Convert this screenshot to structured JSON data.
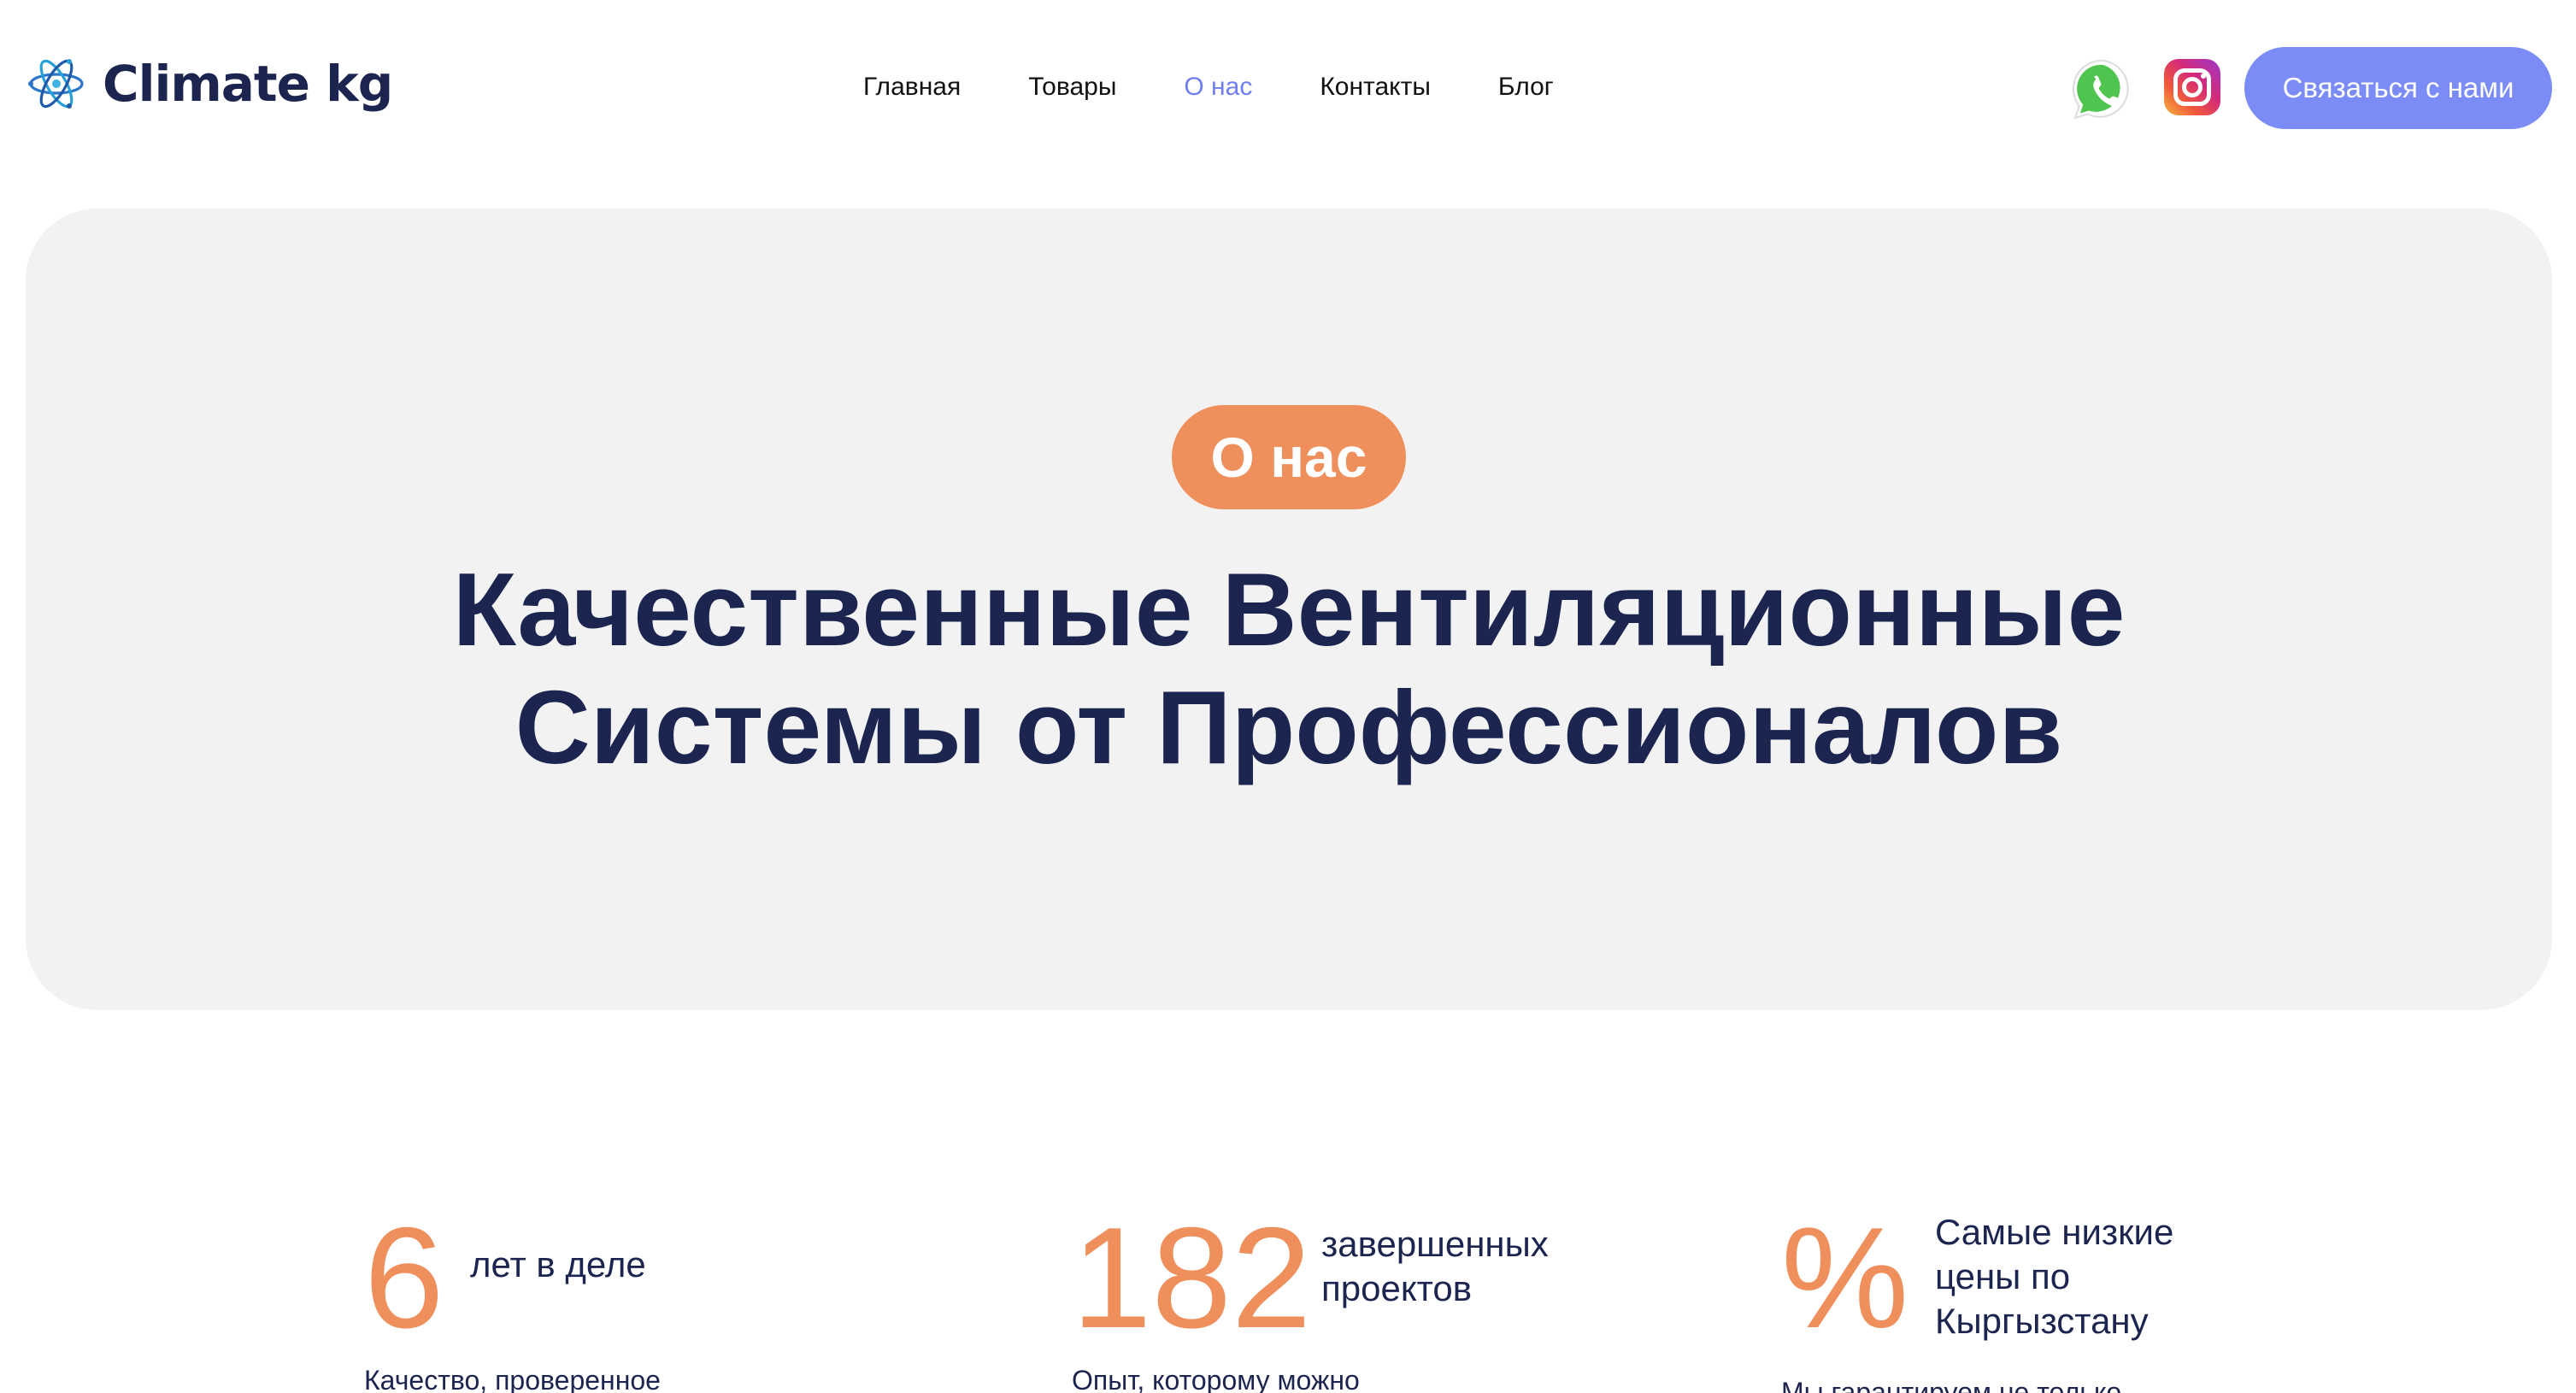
{
  "brand": {
    "name": "Climate kg",
    "logo_icon": "atom-snowflake-icon"
  },
  "nav": {
    "items": [
      {
        "label": "Главная",
        "active": false
      },
      {
        "label": "Товары",
        "active": false
      },
      {
        "label": "О нас",
        "active": true
      },
      {
        "label": "Контакты",
        "active": false
      },
      {
        "label": "Блог",
        "active": false
      }
    ]
  },
  "social": {
    "whatsapp_icon": "whatsapp-icon",
    "instagram_icon": "instagram-icon"
  },
  "cta": {
    "label": "Связаться с нами"
  },
  "hero": {
    "badge": "О нас",
    "title_line1": "Качественные Вентиляционные",
    "title_line2": "Системы от Профессионалов"
  },
  "stats": [
    {
      "number": "6",
      "label_line1": "лет в деле",
      "description": "Качество, проверенное"
    },
    {
      "number": "182",
      "label_line1": "завершенных",
      "label_line2": "проектов",
      "description": "Опыт, которому можно"
    },
    {
      "number": "%",
      "label_line1": "Самые низкие",
      "label_line2": "цены по",
      "label_line3": "Кыргызстану",
      "description": "Мы гарантируем не только"
    }
  ],
  "colors": {
    "accent": "#7b8cf6",
    "orange": "#ef8f5c",
    "navy": "#1c2550",
    "hero_bg": "#f2f2f3"
  }
}
